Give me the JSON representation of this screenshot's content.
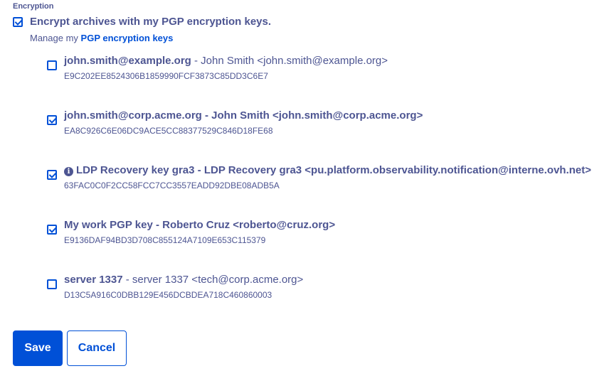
{
  "section": {
    "label": "Encryption"
  },
  "encrypt": {
    "label": "Encrypt archives with my PGP encryption keys.",
    "checked": true
  },
  "manage": {
    "prefix": "Manage my ",
    "link_label": "PGP encryption keys"
  },
  "keys": [
    {
      "email": "john.smith@example.org",
      "description": " - John Smith <john.smith@example.org>",
      "fingerprint": "E9C202EE8524306B1859990FCF3873C85DD3C6E7",
      "checked": false,
      "icon": ""
    },
    {
      "email": "john.smith@corp.acme.org",
      "description": " - John Smith <john.smith@corp.acme.org>",
      "fingerprint": "EA8C926C6E06DC9ACE5CC88377529C846D18FE68",
      "checked": true,
      "icon": ""
    },
    {
      "email": "LDP Recovery key gra3",
      "description": " - LDP Recovery gra3 <pu.platform.observability.notification@interne.ovh.net>",
      "fingerprint": "63FAC0C0F2CC58FCC7CC3557EADD92DBE08ADB5A",
      "checked": true,
      "icon": "info-circle-icon"
    },
    {
      "email": "My work PGP key",
      "description": " - Roberto Cruz <roberto@cruz.org>",
      "fingerprint": "E9136DAF94BD3D708C855124A7109E653C115379",
      "checked": true,
      "icon": ""
    },
    {
      "email": "server 1337",
      "description": " - server 1337 <tech@corp.acme.org>",
      "fingerprint": "D13C5A916C0DBB129E456DCBDEA718C460860003",
      "checked": false,
      "icon": ""
    }
  ],
  "buttons": {
    "save_label": "Save",
    "cancel_label": "Cancel"
  },
  "colors": {
    "primary": "#0050d7",
    "text": "#4d5592"
  }
}
